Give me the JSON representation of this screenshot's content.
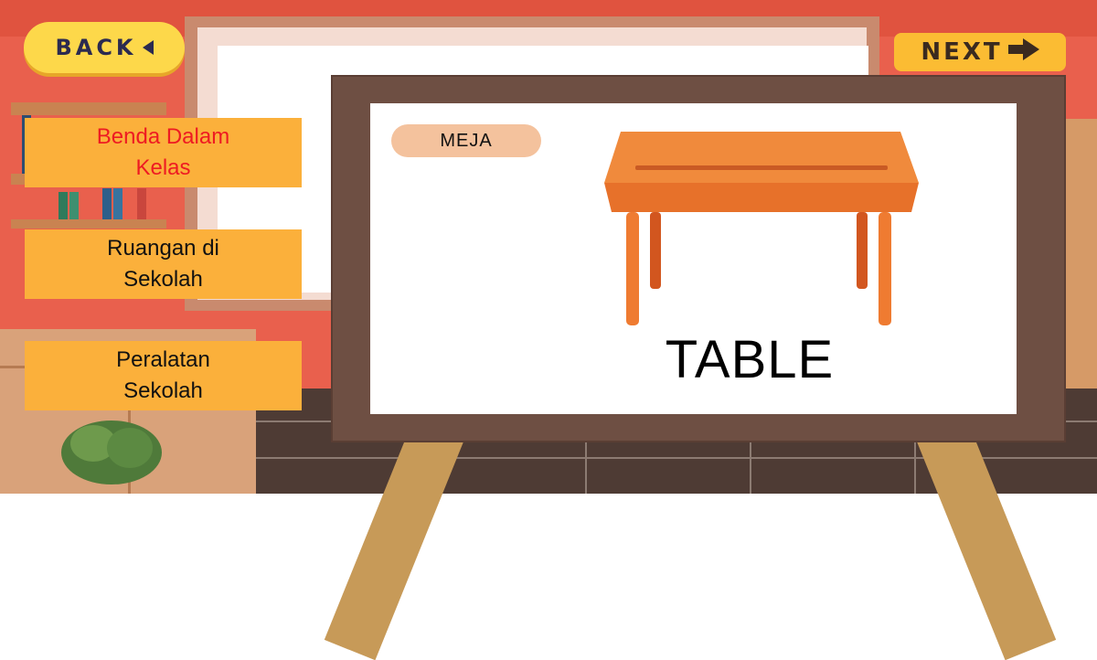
{
  "nav": {
    "back_label": "BACK",
    "next_label": "NEXT"
  },
  "menu": {
    "items": [
      {
        "label": "Benda Dalam\nKelas",
        "active": true
      },
      {
        "label": "Ruangan di\nSekolah",
        "active": false
      },
      {
        "label": "Peralatan\nSekolah",
        "active": false
      }
    ]
  },
  "card": {
    "indonesian_word": "MEJA",
    "english_word": "TABLE",
    "picture_icon": "table-icon"
  },
  "colors": {
    "button_yellow": "#fdd84a",
    "menu_orange": "#fbb03b",
    "active_text": "#ee1b22",
    "board_frame": "#6e4f43",
    "table_orange": "#ed7d2f"
  }
}
